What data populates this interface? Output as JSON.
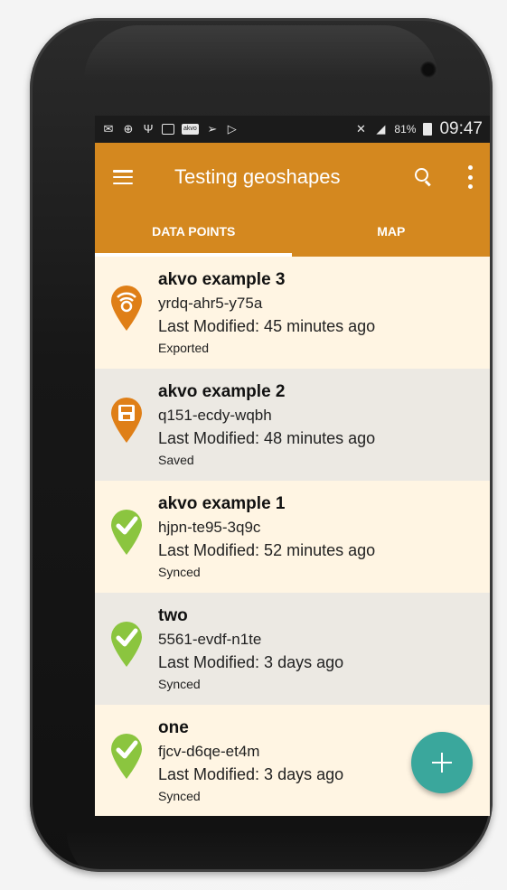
{
  "status_bar": {
    "battery_percent": "81%",
    "time": "09:47",
    "icons": [
      "mail-icon",
      "gps-icon",
      "usb-icon",
      "image-icon",
      "akvo-icon",
      "flash-icon",
      "play-icon",
      "mute-icon",
      "signal-icon",
      "battery-icon"
    ],
    "akvo_badge": "akvo"
  },
  "app_bar": {
    "title": "Testing geoshapes"
  },
  "tabs": [
    {
      "label": "DATA POINTS",
      "active": true
    },
    {
      "label": "MAP",
      "active": false
    }
  ],
  "colors": {
    "primary": "#d4881f",
    "fab": "#3aa79c",
    "pin_orange": "#df7f17",
    "pin_green": "#8bc53f"
  },
  "data_points": [
    {
      "name": "akvo example 3",
      "id": "yrdq-ahr5-y75a",
      "modified": "Last Modified: 45 minutes ago",
      "status": "Exported",
      "icon": "exported-pin-icon"
    },
    {
      "name": "akvo example 2",
      "id": "q151-ecdy-wqbh",
      "modified": "Last Modified: 48 minutes ago",
      "status": "Saved",
      "icon": "saved-pin-icon"
    },
    {
      "name": "akvo example 1",
      "id": "hjpn-te95-3q9c",
      "modified": "Last Modified: 52 minutes ago",
      "status": "Synced",
      "icon": "synced-pin-icon"
    },
    {
      "name": "two",
      "id": "5561-evdf-n1te",
      "modified": "Last Modified: 3 days ago",
      "status": "Synced",
      "icon": "synced-pin-icon"
    },
    {
      "name": "one",
      "id": "fjcv-d6qe-et4m",
      "modified": "Last Modified: 3 days ago",
      "status": "Synced",
      "icon": "synced-pin-icon"
    }
  ]
}
